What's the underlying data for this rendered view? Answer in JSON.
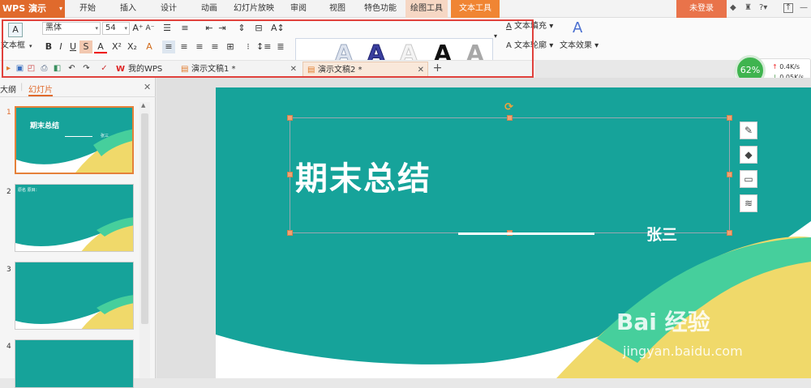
{
  "app": {
    "name": "WPS 演示"
  },
  "menu": [
    "开始",
    "插入",
    "设计",
    "动画",
    "幻灯片放映",
    "审阅",
    "视图",
    "特色功能",
    "绘图工具",
    "文本工具"
  ],
  "topbar": {
    "login": "未登录"
  },
  "ribbon": {
    "textbox_label": "文本框",
    "font_name": "黑体",
    "font_size": "54",
    "text_fill": "文本填充",
    "text_outline": "文本轮廓",
    "text_effect": "文本效果"
  },
  "tabs": {
    "mywps": "我的WPS",
    "doc1": "演示文稿1 *",
    "doc2": "演示文稿2 *"
  },
  "speed": {
    "percent": "62%",
    "up": "0.4K/s",
    "down": "0.05K/s"
  },
  "panel": {
    "outline_tab": "大纲",
    "slides_tab": "幻灯片",
    "slide_numbers": [
      "1",
      "2",
      "3",
      "4"
    ]
  },
  "thumbs": {
    "t1_title": "期末总结",
    "t1_name": "张三",
    "t2_text": "原名 原目："
  },
  "slide": {
    "title": "期末总结",
    "author": "张三"
  },
  "watermark": {
    "line1": "Bai 经验",
    "line2": "jingyan.baidu.com"
  },
  "colors": {
    "teal": "#16a39a",
    "green": "#46cf9c",
    "yellow": "#f0d96a",
    "accent": "#e06a2c",
    "active_tab": "#f08533"
  }
}
